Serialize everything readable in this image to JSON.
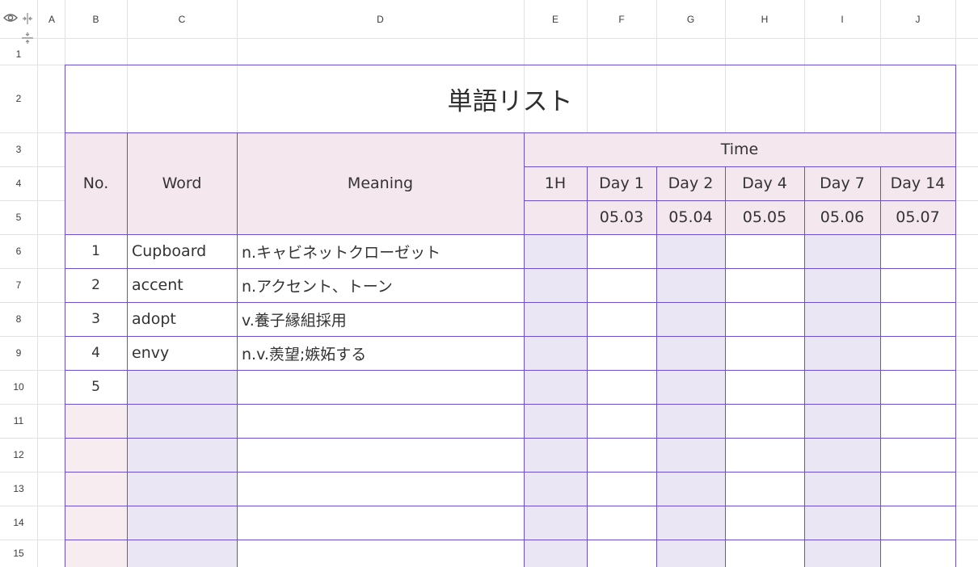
{
  "columns": [
    "A",
    "B",
    "C",
    "D",
    "E",
    "F",
    "G",
    "H",
    "I",
    "J"
  ],
  "rows": [
    "1",
    "2",
    "3",
    "4",
    "5",
    "6",
    "7",
    "8",
    "9",
    "10",
    "11",
    "12",
    "13",
    "14",
    "15"
  ],
  "title": "単語リスト",
  "header": {
    "no": "No.",
    "word": "Word",
    "meaning": "Meaning",
    "time": "Time",
    "intervals": [
      "1H",
      "Day 1",
      "Day 2",
      "Day 4",
      "Day 7",
      "Day 14"
    ],
    "dates": [
      "05.03",
      "05.04",
      "05.05",
      "05.06",
      "05.07"
    ]
  },
  "entries": [
    {
      "no": "1",
      "word": "Cupboard",
      "meaning": "n.キャビネットクローゼット"
    },
    {
      "no": "2",
      "word": "accent",
      "meaning": "n.アクセント、トーン"
    },
    {
      "no": "3",
      "word": "adopt",
      "meaning": "v.養子縁組採用"
    },
    {
      "no": "4",
      "word": "envy",
      "meaning": "n.v.羨望;嫉妬する"
    },
    {
      "no": "5",
      "word": "",
      "meaning": ""
    }
  ],
  "colors": {
    "border": "#6a4fd1",
    "header_bg": "#f4e8ee",
    "column_bg": "#ebe6f4"
  }
}
